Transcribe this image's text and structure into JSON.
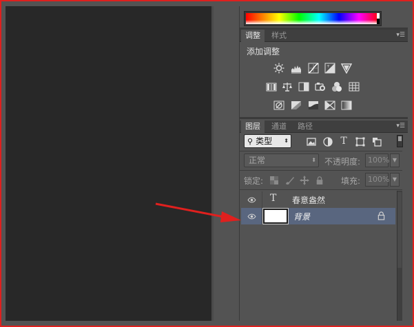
{
  "colors": {
    "frame": "#e0201e",
    "canvas_bg": "#282828",
    "panel_bg": "#535353",
    "selected_row": "#59667f",
    "annotation_arrow": "#e0201e"
  },
  "adjustments_panel": {
    "tabs": [
      "调整",
      "样式"
    ],
    "active_tab": "调整",
    "title": "添加调整",
    "icon_rows": [
      [
        "brightness-contrast-icon",
        "levels-icon",
        "curves-icon",
        "exposure-icon",
        "vibrance-icon"
      ],
      [
        "hue-saturation-icon",
        "color-balance-icon",
        "black-white-icon",
        "photo-filter-icon",
        "channel-mixer-icon",
        "color-lookup-icon"
      ],
      [
        "invert-icon",
        "posterize-icon",
        "threshold-icon",
        "selective-color-icon",
        "gradient-map-icon"
      ]
    ]
  },
  "layers_panel": {
    "tabs": [
      "图层",
      "通道",
      "路径"
    ],
    "active_tab": "图层",
    "kind_filter": {
      "icon": "search-icon",
      "label": "类型"
    },
    "filter_icons": [
      "image-filter-icon",
      "adjustment-filter-icon",
      "type-filter-icon",
      "shape-filter-icon",
      "smart-object-filter-icon"
    ],
    "blend_mode": "正常",
    "opacity_label": "不透明度:",
    "opacity_value": "100%",
    "lock_label": "锁定:",
    "fill_label": "填充:",
    "fill_value": "100%",
    "layers": [
      {
        "type": "text",
        "thumb": "T",
        "name": "春意盎然",
        "selected": false,
        "locked": false
      },
      {
        "type": "background",
        "name": "背景",
        "selected": true,
        "locked": true
      }
    ]
  }
}
